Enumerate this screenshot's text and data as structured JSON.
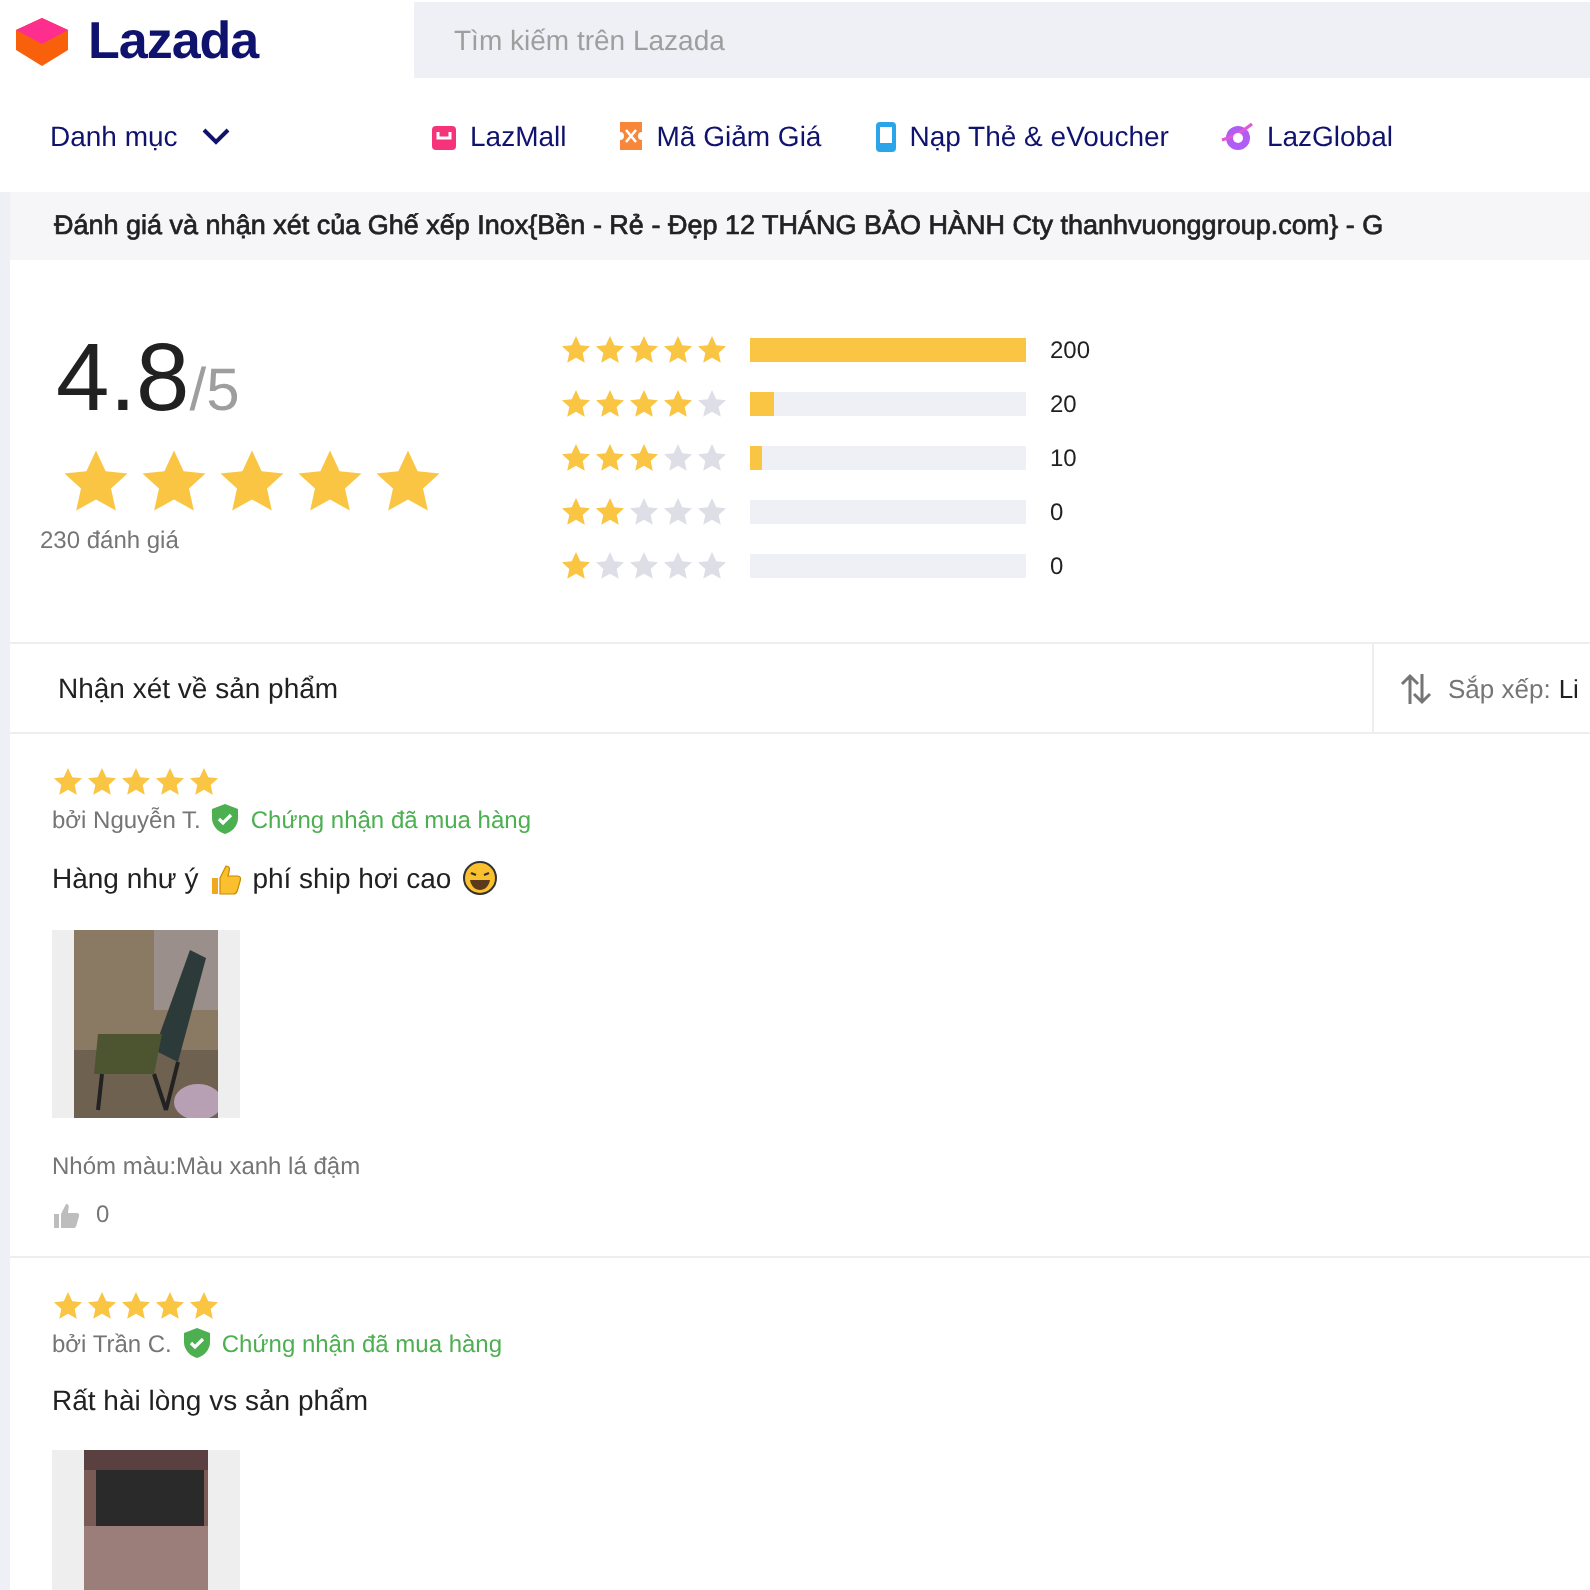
{
  "header": {
    "logo_text": "Lazada",
    "search": {
      "placeholder": "Tìm kiếm trên Lazada"
    }
  },
  "nav": {
    "category": "Danh mục",
    "links": [
      {
        "label": "LazMall",
        "kind": "mall"
      },
      {
        "label": "Mã Giảm Giá",
        "kind": "voucher"
      },
      {
        "label": "Nạp Thẻ & eVoucher",
        "kind": "topup"
      },
      {
        "label": "LazGlobal",
        "kind": "global"
      }
    ]
  },
  "page_title": "Đánh giá và nhận xét của Ghế xếp Inox{Bền - Rẻ - Đẹp 12 THÁNG BẢO HÀNH Cty thanhvuonggroup.com} - G",
  "summary": {
    "score": "4.8",
    "out_of": "/5",
    "stars": 5,
    "count": "230 đánh giá",
    "breakdown": [
      {
        "stars": 5,
        "level": 1,
        "count": "200"
      },
      {
        "stars": 4,
        "level": 0.09,
        "count": "20"
      },
      {
        "stars": 3,
        "level": 0.04,
        "count": "10"
      },
      {
        "stars": 2,
        "count": "0"
      },
      {
        "stars": 1,
        "count": "0"
      }
    ]
  },
  "reviews_header": {
    "title": "Nhận xét về sản phẩm",
    "sort_label": "Sắp xếp:",
    "sort_value": "Li"
  },
  "reviews": [
    {
      "stars": 5,
      "author": "bởi Nguyễn T.",
      "verified": "Chứng nhận đã mua hàng",
      "comment": [
        {
          "kind": "text",
          "text": "Hàng như ý"
        },
        {
          "kind": "thumbs-up"
        },
        {
          "kind": "text",
          "text": "phí ship hơi cao"
        },
        {
          "kind": "laugh"
        }
      ],
      "photo": {
        "kind": "picture"
      },
      "variant": "Nhóm màu:Màu xanh lá đậm",
      "likes": "0"
    },
    {
      "stars": 5,
      "author": "bởi Trần C.",
      "verified": "Chứng nhận đã mua hàng",
      "comment": [
        {
          "kind": "text",
          "text": "Rất hài lòng vs sản phẩm"
        }
      ],
      "photo": {
        "kind": "picture"
      }
    }
  ]
}
